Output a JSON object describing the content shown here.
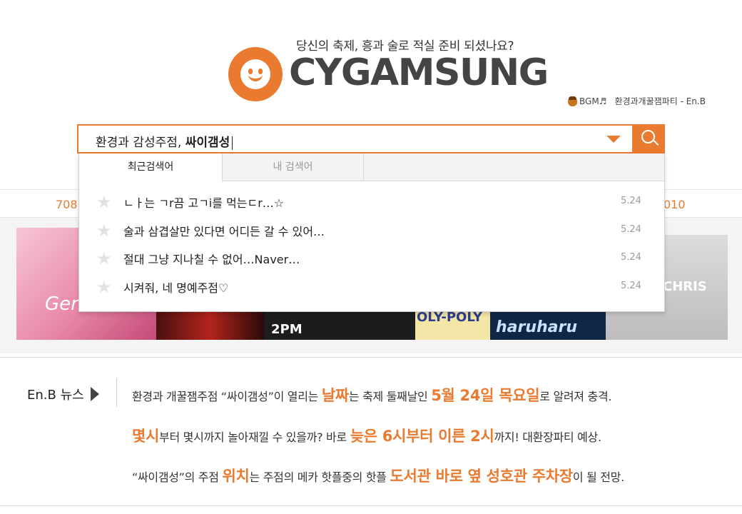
{
  "header": {
    "tagline": "당신의 축제, 흥과 술로 적실 준비 되셨나요?",
    "logo_text": "CYGAMSUNG"
  },
  "bgm": {
    "label": "BGM♬",
    "track": "환경과개꿀잼파티 - En.B"
  },
  "search": {
    "value_normal": "환경과 감성주점, ",
    "value_strong": "싸이갬성"
  },
  "popup": {
    "tabs": [
      "최근검색어",
      "내 검색어"
    ],
    "recent": [
      {
        "text": "ㄴㅏ는 ㄱr끔 고ㄱi를 먹는ㄷr…☆",
        "date": "5.24"
      },
      {
        "text": "술과 삼겹살만 있다면 어디든 갈 수 있어…",
        "date": "5.24"
      },
      {
        "text": "절대 그냥 지나칠 수 없어…Naver…",
        "date": "5.24"
      },
      {
        "text": "시켜줘, 네 명예주점♡",
        "date": "5.24"
      }
    ]
  },
  "ranking": {
    "left_number": "708",
    "right_number": "010"
  },
  "banners": {
    "t1": "Gen",
    "t3": "2PM",
    "t4": "OLY-POLY",
    "t5": "haruharu",
    "t6": "CHRIS"
  },
  "news": {
    "label": "En.B 뉴스",
    "line1": {
      "a": "환경과 개꿀잼주점 “싸이갬성”이 열리는 ",
      "b": "날짜",
      "c": "는 축제 둘째날인 ",
      "d": "5월 24일 목요일",
      "e": "로 알려져 충격."
    },
    "line2": {
      "a": "몇시",
      "b": "부터 몇시까지 놀아재낄 수 있을까? 바로 ",
      "c": "늦은 6시부터 이른 2시",
      "d": "까지! 대환장파티 예상."
    },
    "line3": {
      "a": "“싸이갬성”의 주점 ",
      "b": "위치",
      "c": "는 주점의 메카 핫플중의 핫플 ",
      "d": "도서관 바로 옆 성호관 주차장",
      "e": "이 될 전망."
    }
  }
}
